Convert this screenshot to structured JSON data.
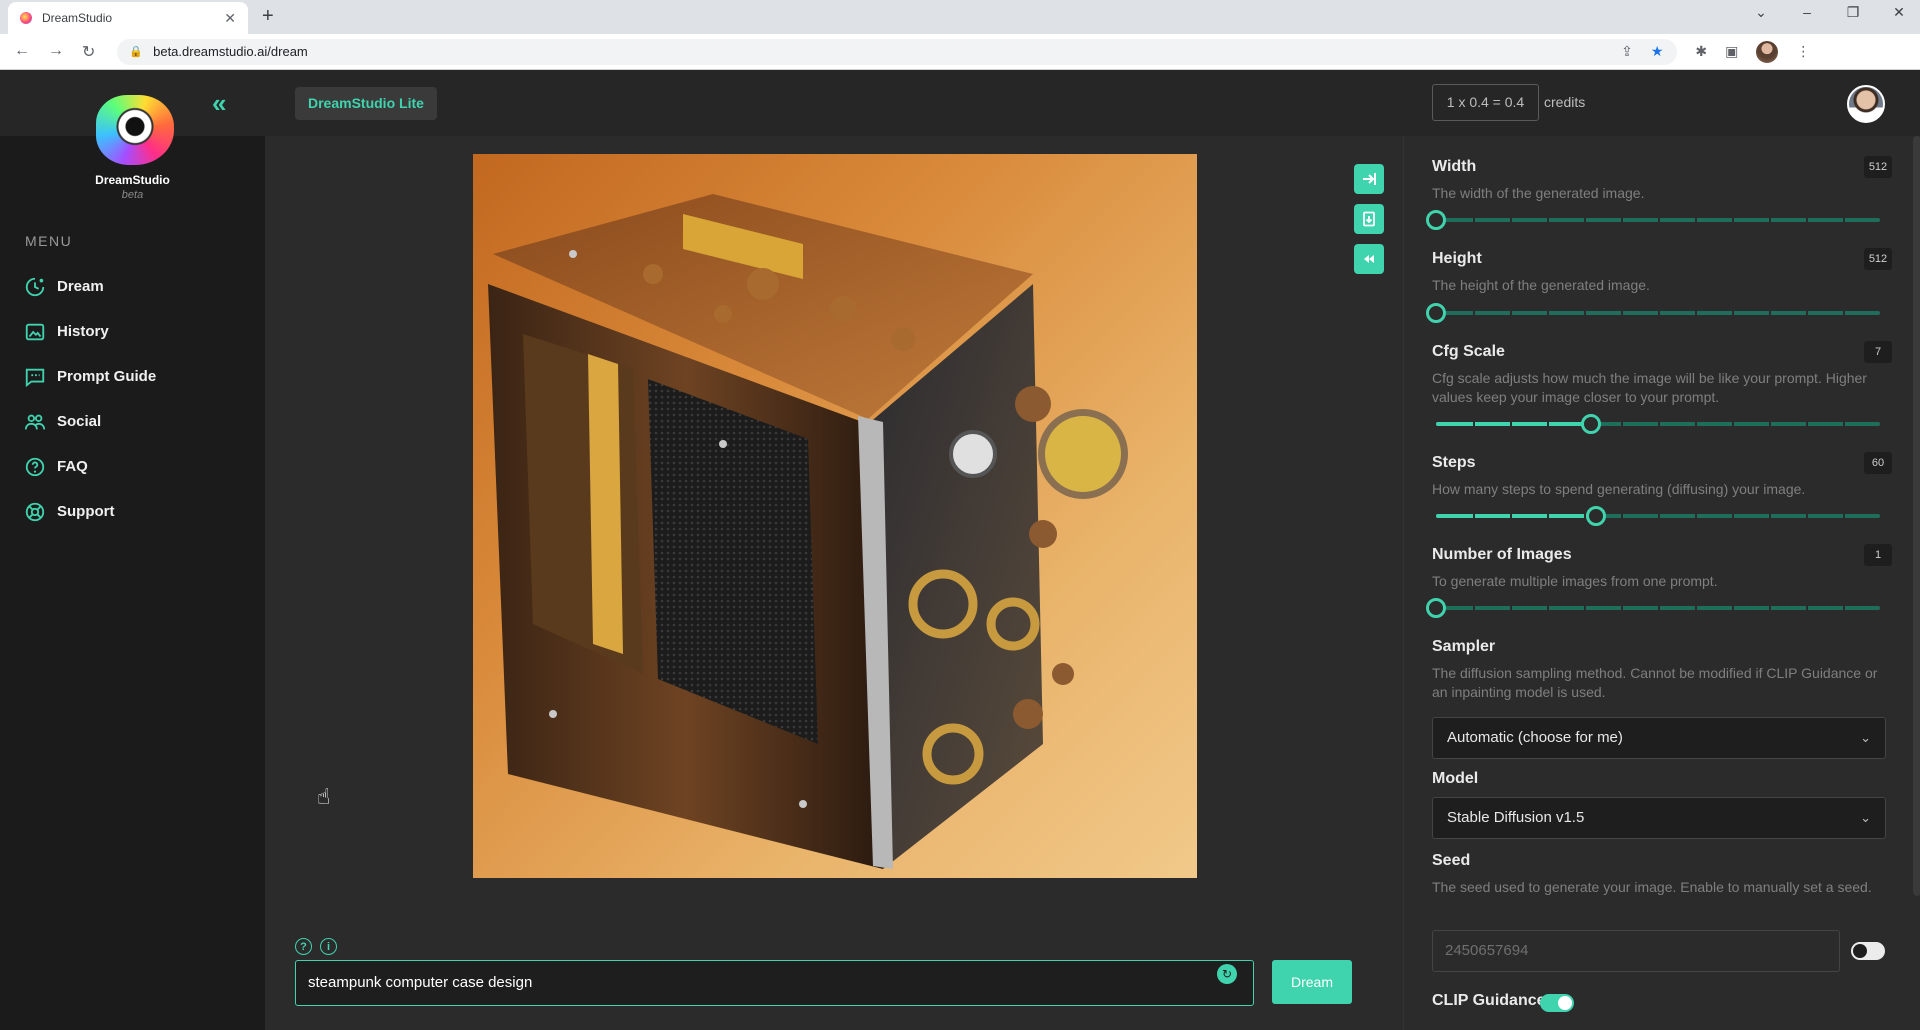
{
  "browser": {
    "tab_title": "DreamStudio",
    "url": "beta.dreamstudio.ai/dream"
  },
  "sidebar": {
    "brand": "DreamStudio",
    "brand_sub": "beta",
    "menu_label": "MENU",
    "items": [
      {
        "label": "Dream",
        "icon": "dream-icon"
      },
      {
        "label": "History",
        "icon": "history-icon"
      },
      {
        "label": "Prompt Guide",
        "icon": "prompt-guide-icon"
      },
      {
        "label": "Social",
        "icon": "social-icon"
      },
      {
        "label": "FAQ",
        "icon": "faq-icon"
      },
      {
        "label": "Support",
        "icon": "support-icon"
      }
    ]
  },
  "header": {
    "badge": "DreamStudio Lite",
    "credits_formula": "1 x 0.4 = 0.4",
    "credits_label": "credits"
  },
  "prompt": {
    "value": "steampunk computer case design",
    "dream_label": "Dream"
  },
  "settings": {
    "width": {
      "label": "Width",
      "desc": "The width of the generated image.",
      "value": "512",
      "fraction": 0.0
    },
    "height": {
      "label": "Height",
      "desc": "The height of the generated image.",
      "value": "512",
      "fraction": 0.0
    },
    "cfg": {
      "label": "Cfg Scale",
      "desc": "Cfg scale adjusts how much the image will be like your prompt. Higher values keep your image closer to your prompt.",
      "value": "7",
      "fraction": 0.35
    },
    "steps": {
      "label": "Steps",
      "desc": "How many steps to spend generating (diffusing) your image.",
      "value": "60",
      "fraction": 0.36
    },
    "num_images": {
      "label": "Number of Images",
      "desc": "To generate multiple images from one prompt.",
      "value": "1",
      "fraction": 0.0
    },
    "sampler": {
      "label": "Sampler",
      "desc": "The diffusion sampling method. Cannot be modified if CLIP Guidance or an inpainting model is used.",
      "value": "Automatic (choose for me)"
    },
    "model": {
      "label": "Model",
      "value": "Stable Diffusion v1.5"
    },
    "seed": {
      "label": "Seed",
      "desc": "The seed used to generate your image. Enable to manually set a seed.",
      "placeholder": "2450657694",
      "enabled": false
    },
    "clip": {
      "label": "CLIP Guidance",
      "enabled": true
    }
  },
  "colors": {
    "accent": "#3fd3ae",
    "track": "#1f6e5b",
    "panel": "#2b2b2b",
    "sidebar": "#1b1b1b"
  }
}
